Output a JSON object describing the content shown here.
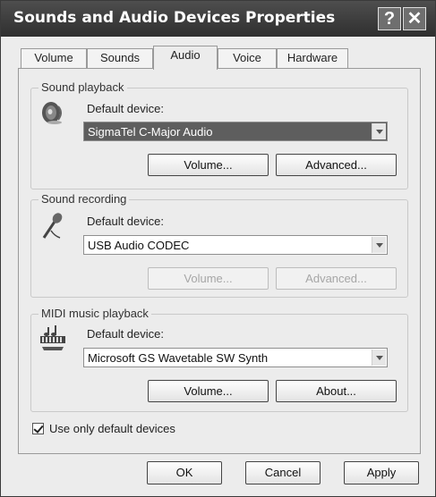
{
  "window": {
    "title": "Sounds and Audio Devices Properties",
    "help_glyph": "?",
    "close_glyph": "✕"
  },
  "tabs": [
    {
      "label": "Volume"
    },
    {
      "label": "Sounds"
    },
    {
      "label": "Audio",
      "active": true
    },
    {
      "label": "Voice"
    },
    {
      "label": "Hardware"
    }
  ],
  "playback": {
    "group_label": "Sound playback",
    "device_label": "Default device:",
    "device_value": "SigmaTel C-Major Audio",
    "volume_label": "Volume...",
    "advanced_label": "Advanced..."
  },
  "recording": {
    "group_label": "Sound recording",
    "device_label": "Default device:",
    "device_value": "USB Audio CODEC",
    "volume_label": "Volume...",
    "advanced_label": "Advanced..."
  },
  "midi": {
    "group_label": "MIDI music playback",
    "device_label": "Default device:",
    "device_value": "Microsoft GS Wavetable SW Synth",
    "volume_label": "Volume...",
    "about_label": "About..."
  },
  "use_default_only": {
    "label": "Use only default devices",
    "checked": true
  },
  "footer": {
    "ok_label": "OK",
    "cancel_label": "Cancel",
    "apply_label": "Apply"
  },
  "icons": {
    "playback": "speaker-icon",
    "recording": "microphone-icon",
    "midi": "midi-keyboard-icon"
  },
  "colors": {
    "titlebar": "#3a3a3a",
    "selection": "#5e5e5e",
    "dialog_bg": "#ececec"
  }
}
